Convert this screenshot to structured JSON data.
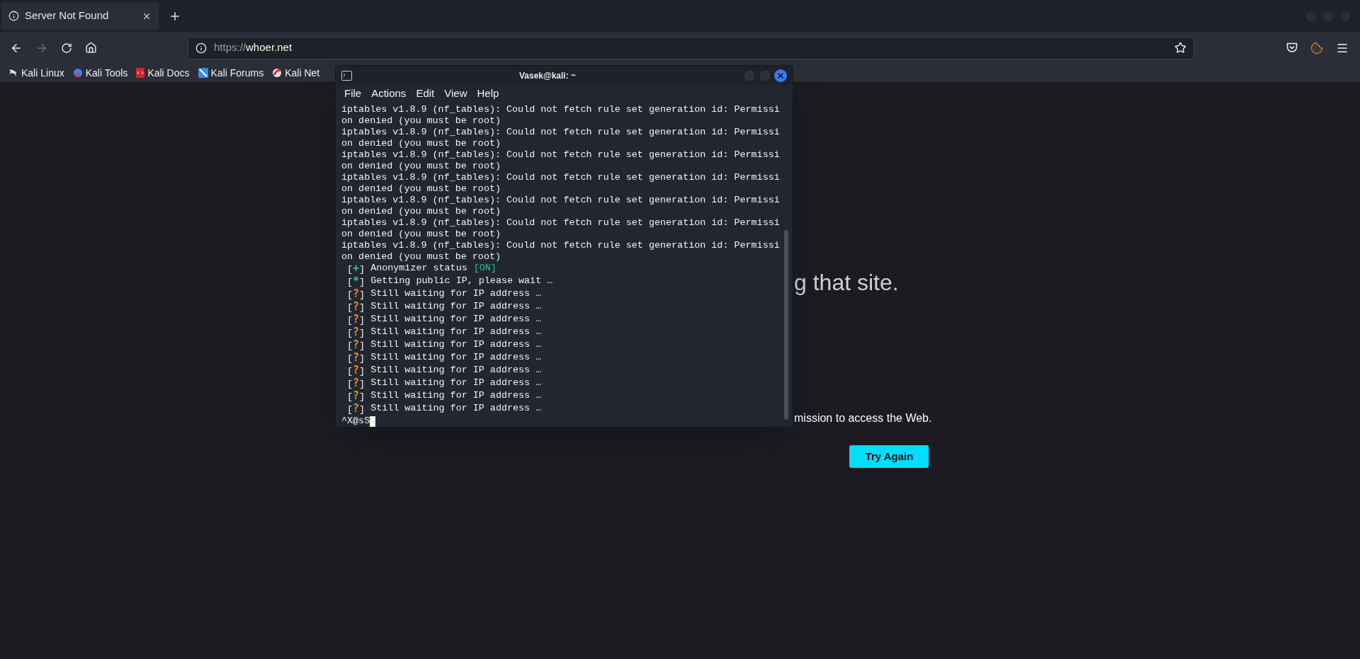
{
  "browser": {
    "tab": {
      "title": "Server Not Found",
      "selected": true
    },
    "nav": {
      "back_disabled": false,
      "forward_disabled": true
    },
    "url": {
      "scheme": "https://",
      "host": "whoer.net"
    },
    "bookmarks": [
      {
        "label": "Kali Linux"
      },
      {
        "label": "Kali Tools"
      },
      {
        "label": "Kali Docs"
      },
      {
        "label": "Kali Forums"
      },
      {
        "label": "Kali Net"
      }
    ]
  },
  "page": {
    "heading_fragment": "g that site.",
    "list_fragment": "mission to access the Web.",
    "button": "Try Again"
  },
  "terminal": {
    "title": "Vasek@kali: ~",
    "menu": [
      "File",
      "Actions",
      "Edit",
      "View",
      "Help"
    ],
    "lines": [
      {
        "kind": "plain",
        "text": "iptables v1.8.9 (nf_tables): Could not fetch rule set generation id: Permissi"
      },
      {
        "kind": "plain",
        "text": "on denied (you must be root)"
      },
      {
        "kind": "plain",
        "text": "iptables v1.8.9 (nf_tables): Could not fetch rule set generation id: Permissi"
      },
      {
        "kind": "plain",
        "text": "on denied (you must be root)"
      },
      {
        "kind": "plain",
        "text": "iptables v1.8.9 (nf_tables): Could not fetch rule set generation id: Permissi"
      },
      {
        "kind": "plain",
        "text": "on denied (you must be root)"
      },
      {
        "kind": "plain",
        "text": "iptables v1.8.9 (nf_tables): Could not fetch rule set generation id: Permissi"
      },
      {
        "kind": "plain",
        "text": "on denied (you must be root)"
      },
      {
        "kind": "plain",
        "text": "iptables v1.8.9 (nf_tables): Could not fetch rule set generation id: Permissi"
      },
      {
        "kind": "plain",
        "text": "on denied (you must be root)"
      },
      {
        "kind": "plain",
        "text": "iptables v1.8.9 (nf_tables): Could not fetch rule set generation id: Permissi"
      },
      {
        "kind": "plain",
        "text": "on denied (you must be root)"
      },
      {
        "kind": "plain",
        "text": "iptables v1.8.9 (nf_tables): Could not fetch rule set generation id: Permissi"
      },
      {
        "kind": "plain",
        "text": "on denied (you must be root)"
      },
      {
        "kind": "status",
        "open": "[",
        "symbol": "+",
        "close": "]",
        "color": "#2bbfa4",
        "text": "Anonymizer status",
        "tag": "[ON]"
      },
      {
        "kind": "status",
        "open": "[",
        "symbol": "*",
        "close": "]",
        "color": "#2bbfa4",
        "text": "Getting public IP, please wait …"
      },
      {
        "kind": "status",
        "open": "[",
        "symbol": "?",
        "close": "]",
        "color": "#e58a2e",
        "text": "Still waiting for IP address …"
      },
      {
        "kind": "status",
        "open": "[",
        "symbol": "?",
        "close": "]",
        "color": "#e58a2e",
        "text": "Still waiting for IP address …"
      },
      {
        "kind": "status",
        "open": "[",
        "symbol": "?",
        "close": "]",
        "color": "#e58a2e",
        "text": "Still waiting for IP address …"
      },
      {
        "kind": "status",
        "open": "[",
        "symbol": "?",
        "close": "]",
        "color": "#e58a2e",
        "text": "Still waiting for IP address …"
      },
      {
        "kind": "status",
        "open": "[",
        "symbol": "?",
        "close": "]",
        "color": "#e58a2e",
        "text": "Still waiting for IP address …"
      },
      {
        "kind": "status",
        "open": "[",
        "symbol": "?",
        "close": "]",
        "color": "#e58a2e",
        "text": "Still waiting for IP address …"
      },
      {
        "kind": "status",
        "open": "[",
        "symbol": "?",
        "close": "]",
        "color": "#e58a2e",
        "text": "Still waiting for IP address …"
      },
      {
        "kind": "status",
        "open": "[",
        "symbol": "?",
        "close": "]",
        "color": "#e58a2e",
        "text": "Still waiting for IP address …"
      },
      {
        "kind": "status",
        "open": "[",
        "symbol": "?",
        "close": "]",
        "color": "#e58a2e",
        "text": "Still waiting for IP address …"
      },
      {
        "kind": "status",
        "open": "[",
        "symbol": "?",
        "close": "]",
        "color": "#e58a2e",
        "text": "Still waiting for IP address …"
      },
      {
        "kind": "prompt",
        "text": "^X@sS"
      }
    ]
  }
}
